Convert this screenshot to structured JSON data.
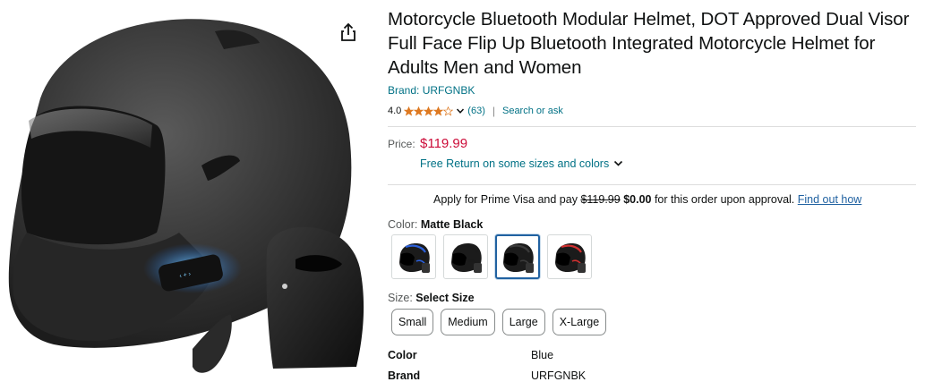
{
  "product": {
    "title": "Motorcycle Bluetooth Modular Helmet, DOT Approved Dual Visor Full Face Flip Up Bluetooth Integrated Motorcycle Helmet for Adults Men and Women",
    "brand_link": "Brand: URFGNBK",
    "rating": "4.0",
    "rating_value": 4.0,
    "review_count": "(63)",
    "ask_link": "Search or ask",
    "price_label": "Price:",
    "price": "$119.99",
    "free_return": "Free Return on some sizes and colors",
    "prime": {
      "prefix": "Apply for Prime Visa and pay ",
      "old_price": "$119.99",
      "new_price": "$0.00",
      "suffix": " for this order upon approval. ",
      "link": "Find out how"
    },
    "color_label": "Color: ",
    "color_selected": "Matte Black",
    "swatches": [
      {
        "name": "Blue",
        "accent": "#2b5fd9"
      },
      {
        "name": "Black",
        "accent": "#1a1a1a"
      },
      {
        "name": "Matte Black",
        "accent": "#3a3a3a",
        "selected": true
      },
      {
        "name": "Red",
        "accent": "#d03030"
      }
    ],
    "size_label": "Size: ",
    "size_selected": "Select Size",
    "sizes": [
      "Small",
      "Medium",
      "Large",
      "X-Large"
    ],
    "specs": [
      {
        "key": "Color",
        "value": "Blue"
      },
      {
        "key": "Brand",
        "value": "URFGNBK"
      }
    ]
  },
  "colors": {
    "link": "#007185",
    "price": "#cc0c39",
    "star": "#de7921",
    "selected_border": "#2162a1"
  }
}
